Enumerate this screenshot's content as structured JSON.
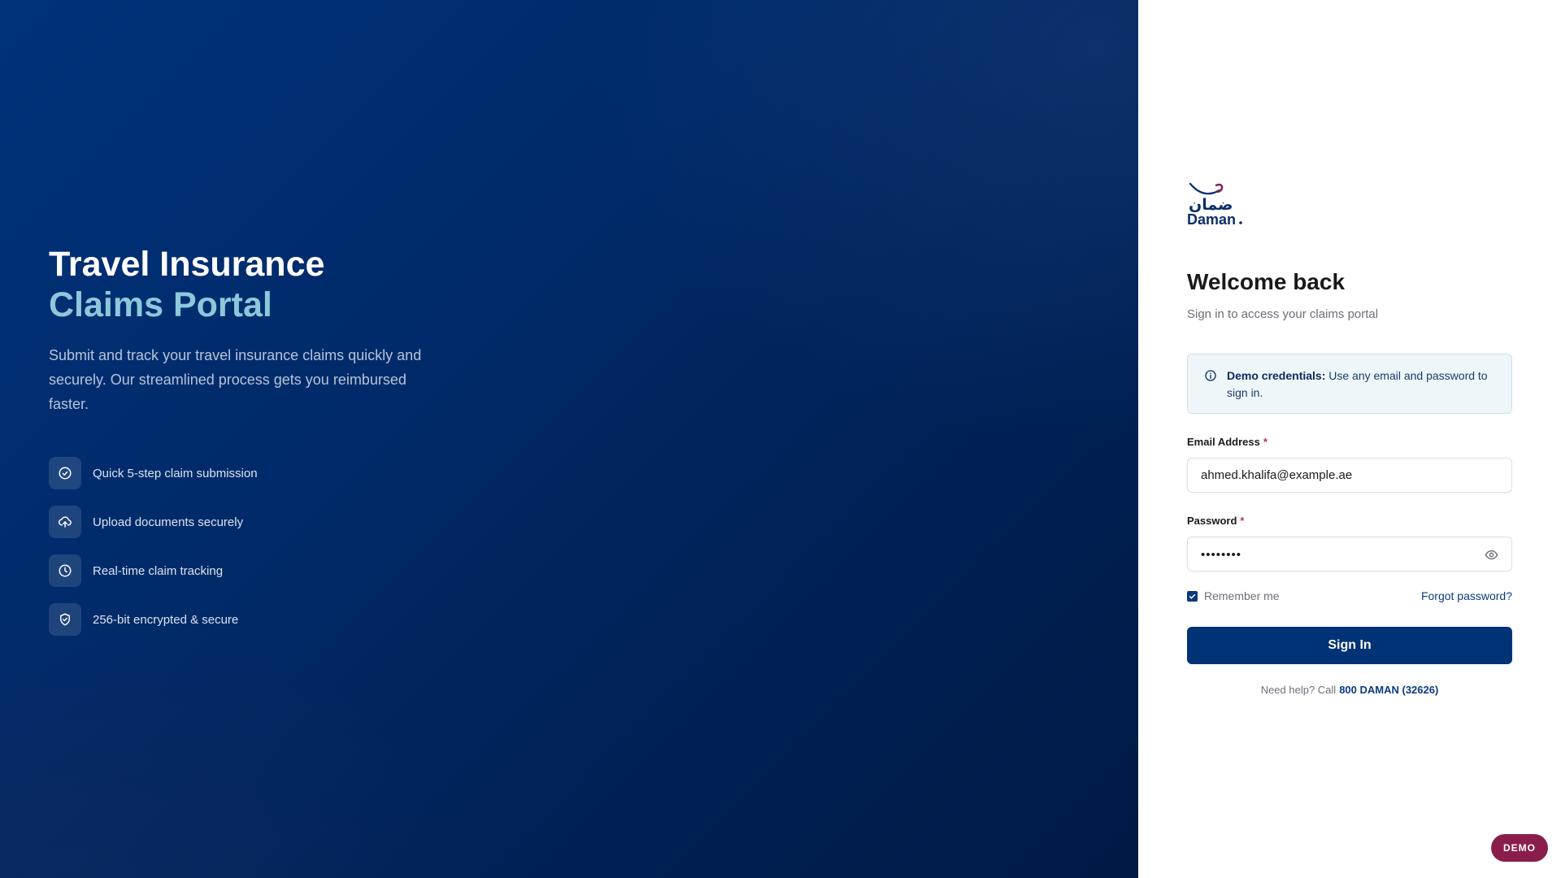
{
  "hero": {
    "title": "Travel Insurance",
    "title_accent": "Claims Portal",
    "description": "Submit and track your travel insurance claims quickly and securely. Our streamlined process gets you reimbursed faster.",
    "features": [
      {
        "label": "Quick 5-step claim submission",
        "icon": "check-circle-icon"
      },
      {
        "label": "Upload documents securely",
        "icon": "cloud-upload-icon"
      },
      {
        "label": "Real-time claim tracking",
        "icon": "clock-icon"
      },
      {
        "label": "256-bit encrypted & secure",
        "icon": "shield-check-icon"
      }
    ]
  },
  "brand": {
    "logo_text_ar": "ضمان",
    "logo_text_en": "Daman",
    "primary_color": "#003276",
    "accent_color": "#8cc8dc",
    "logo_accent_color": "#8b1d4a"
  },
  "login": {
    "heading": "Welcome back",
    "subtitle": "Sign in to access your claims portal",
    "notice_strong": "Demo credentials:",
    "notice_text": "Use any email and password to sign in.",
    "email_label": "Email Address",
    "email_value": "ahmed.khalifa@example.ae",
    "password_label": "Password",
    "password_masked": "••••••••",
    "required_mark": "*",
    "remember_label": "Remember me",
    "remember_checked": true,
    "forgot_label": "Forgot password?",
    "signin_label": "Sign In",
    "help_text": "Need help? Call",
    "help_phone": "800 DAMAN (32626)"
  },
  "badge": {
    "label": "DEMO"
  }
}
